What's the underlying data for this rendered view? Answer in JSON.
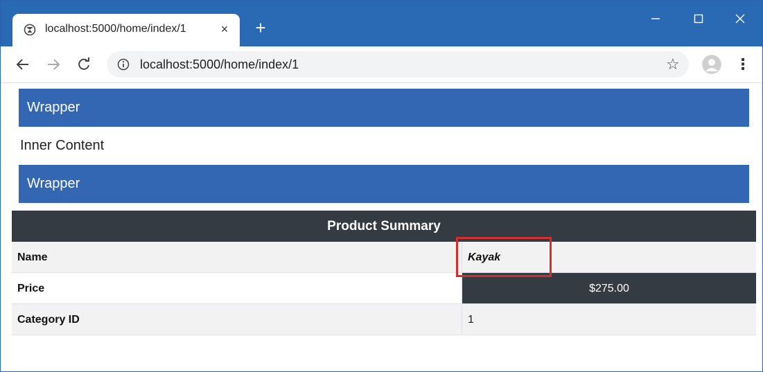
{
  "browser": {
    "tab_title": "localhost:5000/home/index/1",
    "tab_close": "×",
    "new_tab": "+",
    "url_host": "localhost",
    "url_rest": ":5000/home/index/1",
    "window_controls": {
      "minimize": "–",
      "maximize": "☐",
      "close": "✕"
    },
    "icons": [
      "globe-icon",
      "back-icon",
      "forward-icon",
      "reload-icon",
      "info-icon",
      "star-icon",
      "profile-icon",
      "menu-icon"
    ]
  },
  "page": {
    "wrapper_top": "Wrapper",
    "inner_content": "Inner Content",
    "wrapper_bottom": "Wrapper",
    "table": {
      "heading": "Product Summary",
      "rows": [
        {
          "label": "Name",
          "value": "Kayak"
        },
        {
          "label": "Price",
          "value": "$275.00"
        },
        {
          "label": "Category ID",
          "value": "1"
        }
      ]
    }
  },
  "colors": {
    "titlebar": "#2a6ab4",
    "wrapper_bg": "#3367b3",
    "table_dark": "#353b43",
    "highlight_border": "#d32f2f"
  }
}
